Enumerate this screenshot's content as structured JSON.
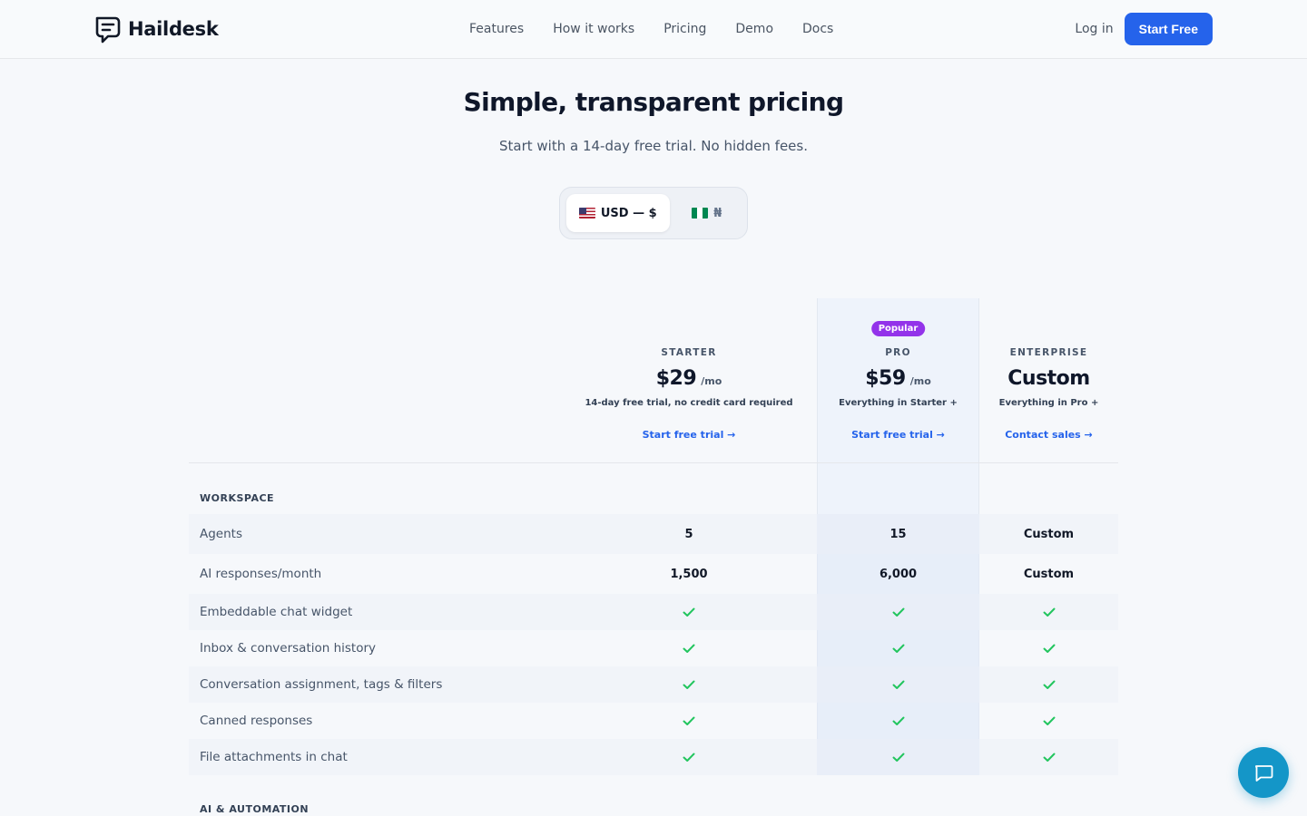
{
  "brand": {
    "name": "Haildesk"
  },
  "nav": {
    "links": [
      "Features",
      "How it works",
      "Pricing",
      "Demo",
      "Docs"
    ],
    "login": "Log in",
    "cta": "Start Free"
  },
  "hero": {
    "title": "Simple, transparent pricing",
    "subtitle": "Start with a 14-day free trial. No hidden fees."
  },
  "currency": {
    "options": [
      {
        "label": "USD — $",
        "flag": "flag-us-icon",
        "active": true
      },
      {
        "label": "₦",
        "flag": "flag-ng-icon",
        "active": false
      }
    ]
  },
  "plans": [
    {
      "name": "STARTER",
      "price": "$29",
      "unit": "/mo",
      "desc": "14-day free trial, no credit card required",
      "cta": "Start free trial →",
      "badge": ""
    },
    {
      "name": "PRO",
      "price": "$59",
      "unit": "/mo",
      "desc": "Everything in Starter +",
      "cta": "Start free trial →",
      "badge": "Popular"
    },
    {
      "name": "ENTERPRISE",
      "price": "Custom",
      "unit": "",
      "desc": "Everything in Pro +",
      "cta": "Contact sales →",
      "badge": ""
    }
  ],
  "sections": [
    {
      "title": "WORKSPACE",
      "rows": [
        {
          "label": "Agents",
          "values": [
            "5",
            "15",
            "Custom"
          ]
        },
        {
          "label": "AI responses/month",
          "values": [
            "1,500",
            "6,000",
            "Custom"
          ]
        },
        {
          "label": "Embeddable chat widget",
          "values": [
            "check",
            "check",
            "check"
          ]
        },
        {
          "label": "Inbox & conversation history",
          "values": [
            "check",
            "check",
            "check"
          ]
        },
        {
          "label": "Conversation assignment, tags & filters",
          "values": [
            "check",
            "check",
            "check"
          ]
        },
        {
          "label": "Canned responses",
          "values": [
            "check",
            "check",
            "check"
          ]
        },
        {
          "label": "File attachments in chat",
          "values": [
            "check",
            "check",
            "check"
          ]
        }
      ]
    },
    {
      "title": "AI & AUTOMATION",
      "rows": []
    }
  ],
  "colors": {
    "accent": "#2563eb",
    "badge": "#9333ea",
    "check": "#22c55e",
    "chat_fab": "#1496c8"
  }
}
